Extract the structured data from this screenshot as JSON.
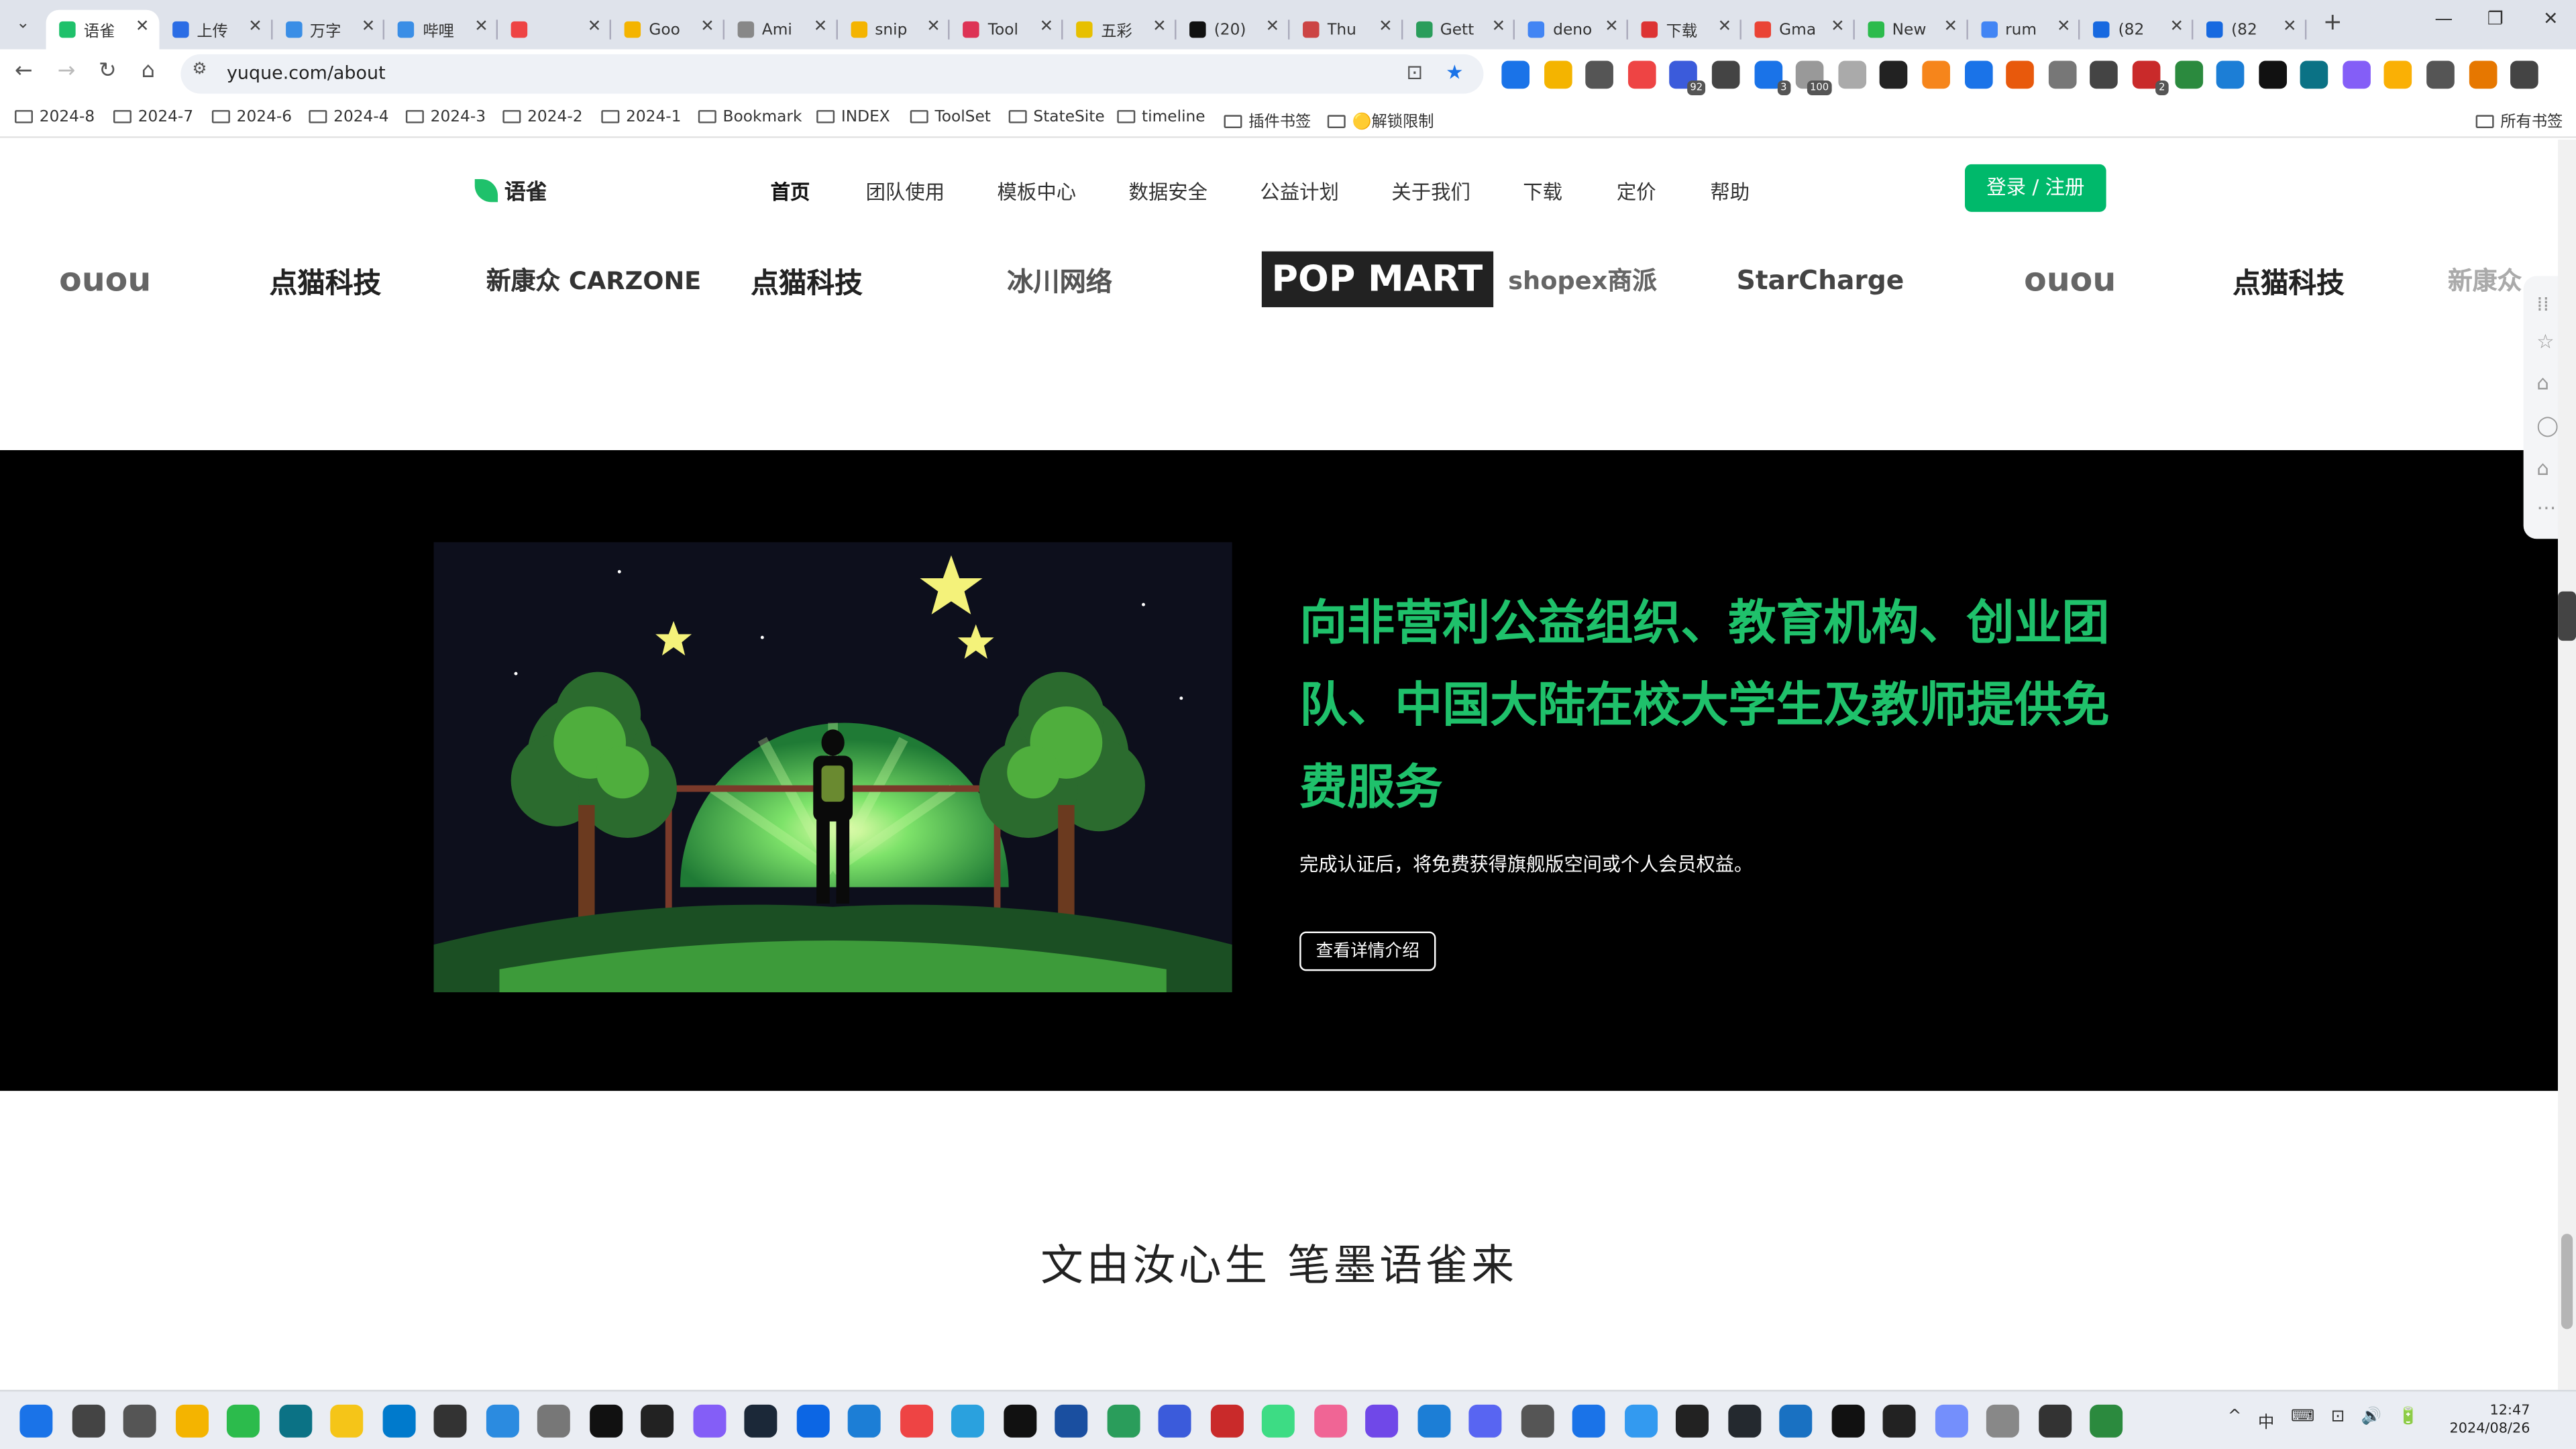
{
  "browser": {
    "tabs": [
      {
        "title": "语雀",
        "favicon_color": "#1fc16b",
        "active": true
      },
      {
        "title": "上传",
        "favicon_color": "#2b6de5"
      },
      {
        "title": "万字",
        "favicon_color": "#3a8ee6"
      },
      {
        "title": "哔哩",
        "favicon_color": "#3a8ee6"
      },
      {
        "title": "",
        "favicon_color": "#e44"
      },
      {
        "title": "Goo",
        "favicon_color": "#f4b400"
      },
      {
        "title": "Ami",
        "favicon_color": "#888"
      },
      {
        "title": "snip",
        "favicon_color": "#f4b400"
      },
      {
        "title": "Tool",
        "favicon_color": "#d35"
      },
      {
        "title": "五彩",
        "favicon_color": "#e7c000"
      },
      {
        "title": "(20)",
        "favicon_color": "#111"
      },
      {
        "title": "Thu",
        "favicon_color": "#c44"
      },
      {
        "title": "Gett",
        "favicon_color": "#2a9d5b"
      },
      {
        "title": "deno",
        "favicon_color": "#4285f4"
      },
      {
        "title": "下载",
        "favicon_color": "#d33"
      },
      {
        "title": "Gma",
        "favicon_color": "#ea4335"
      },
      {
        "title": "New",
        "favicon_color": "#2cbb4c"
      },
      {
        "title": "rum",
        "favicon_color": "#4285f4"
      },
      {
        "title": "(82",
        "favicon_color": "#1769e0"
      },
      {
        "title": "(82",
        "favicon_color": "#1769e0"
      }
    ],
    "new_tab_label": "+",
    "window_controls": {
      "minimize": "—",
      "restore": "❐",
      "close": "✕"
    },
    "tab_search": "⌄",
    "nav": {
      "back": "←",
      "forward": "→",
      "reload": "↻",
      "home": "⌂"
    },
    "url": "yuque.com/about",
    "omnibox_icons": {
      "install": "⊡",
      "star": "★"
    },
    "extensions": [
      {
        "name": "ext-blue-icon",
        "color": "#1a73e8"
      },
      {
        "name": "ext-star-icon",
        "color": "#f4b400"
      },
      {
        "name": "ext-trophy-icon",
        "color": "#555"
      },
      {
        "name": "ext-multicolor-icon",
        "color": "#e44"
      },
      {
        "name": "ext-92-icon",
        "color": "#3b5bdb",
        "badge": "92"
      },
      {
        "name": "ext-cloud-icon",
        "color": "#444"
      },
      {
        "name": "ext-3-icon",
        "color": "#1a73e8",
        "badge": "3"
      },
      {
        "name": "ext-100-icon",
        "color": "#999",
        "badge": "100"
      },
      {
        "name": "ext-undo-icon",
        "color": "#aaa"
      },
      {
        "name": "ext-dark-icon",
        "color": "#222"
      },
      {
        "name": "ext-fox-icon",
        "color": "#f6851b"
      },
      {
        "name": "ext-y-icon",
        "color": "#1a73e8"
      },
      {
        "name": "ext-orange-icon",
        "color": "#e8590c"
      },
      {
        "name": "ext-m-icon",
        "color": "#777"
      },
      {
        "name": "ext-shield-icon",
        "color": "#444"
      },
      {
        "name": "ext-2-icon",
        "color": "#c92a2a",
        "badge": "2"
      },
      {
        "name": "ext-green-icon",
        "color": "#2b8a3e"
      },
      {
        "name": "ext-photo-icon",
        "color": "#1c7ed6"
      },
      {
        "name": "ext-k-icon",
        "color": "#111"
      },
      {
        "name": "ext-teal-icon",
        "color": "#0b7285"
      },
      {
        "name": "ext-color-icon",
        "color": "#845ef7"
      },
      {
        "name": "ext-pen-icon",
        "color": "#fab005"
      },
      {
        "name": "ext-puzzle-icon",
        "color": "#555"
      },
      {
        "name": "ext-bar-icon",
        "color": "#e67700"
      },
      {
        "name": "ext-menu-icon",
        "color": "#444"
      }
    ],
    "bookmarks": [
      "2024-8",
      "2024-7",
      "2024-6",
      "2024-4",
      "2024-3",
      "2024-2",
      "2024-1",
      "Bookmark",
      "INDEX",
      "ToolSet",
      "StateSite",
      "timeline",
      "插件书签",
      "🟡解锁限制"
    ],
    "all_bookmarks": "所有书签"
  },
  "site": {
    "logo": "语雀",
    "menu": [
      "首页",
      "团队使用",
      "模板中心",
      "数据安全",
      "公益计划",
      "关于我们",
      "下载",
      "定价",
      "帮助"
    ],
    "login": "登录 / 注册",
    "partner_logos": [
      "ouou",
      "点猫科技",
      "新康众 CARZONE",
      "点猫科技",
      "冰川网络",
      "POP MART",
      "shopex商派",
      "StarCharge",
      "ouou",
      "点猫科技",
      "新康众"
    ],
    "headline": "向非营利公益组织、教育机构、创业团队、中国大陆在校大学生及教师提供免费服务",
    "subtitle": "完成认证后，将免费获得旗舰版空间或个人会员权益。",
    "detail_button": "查看详情介绍",
    "slogan": "文由汝心生 笔墨语雀来",
    "brand_color": "#1fc16b"
  },
  "taskbar": {
    "apps": [
      "windows-start",
      "search",
      "task-view",
      "chrome",
      "wechat",
      "camera",
      "file-explorer",
      "vscode",
      "obs",
      "browser",
      "dots",
      "notion",
      "notes",
      "gem",
      "steam",
      "board",
      "store",
      "grid",
      "telegram",
      "tiktok",
      "shield",
      "vpn",
      "123",
      "cube",
      "android",
      "cat",
      "folder",
      "check",
      "discord",
      "settings",
      "box",
      "map",
      "terminal",
      "github",
      "chat",
      "z",
      "dark",
      "calc",
      "photos",
      "calendar",
      "monitor"
    ],
    "tray_icons": [
      "^",
      "中",
      "⌨",
      "⊡",
      "🔊",
      "🔋"
    ],
    "time": "12:47",
    "date": "2024/08/26"
  }
}
